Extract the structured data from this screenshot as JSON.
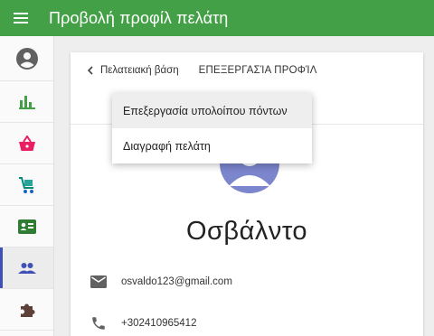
{
  "appbar": {
    "title": "Προβολή προφίλ πελάτη"
  },
  "sidebar": {
    "items": [
      {
        "icon": "account-circle-icon",
        "color": "#616161"
      },
      {
        "icon": "bar-chart-icon",
        "color": "#43a047"
      },
      {
        "icon": "shopping-basket-icon",
        "color": "#e91e63"
      },
      {
        "icon": "cart-icon",
        "color": "#00897b"
      },
      {
        "icon": "contact-card-icon",
        "color": "#2e7d32"
      },
      {
        "icon": "people-icon",
        "color": "#3f51b5",
        "active": true
      },
      {
        "icon": "extension-icon",
        "color": "#5d4037"
      }
    ]
  },
  "card": {
    "breadcrumb_back": "Πελατειακή βάση",
    "breadcrumb_current": "ΕΠΕΞΕΡΓΑΣΊΑ ΠΡΟΦΊΛ",
    "customer_name": "Οσβάλντο",
    "email": "osvaldo123@gmail.com",
    "phone": "+302410965412"
  },
  "dropdown": {
    "items": [
      "Επεξεργασία υπολοίπου πόντων",
      "Διαγραφή πελάτη"
    ]
  },
  "colors": {
    "appbar": "#43a047",
    "avatar": "#7b86cc",
    "active_nav": "#3f51b5"
  }
}
